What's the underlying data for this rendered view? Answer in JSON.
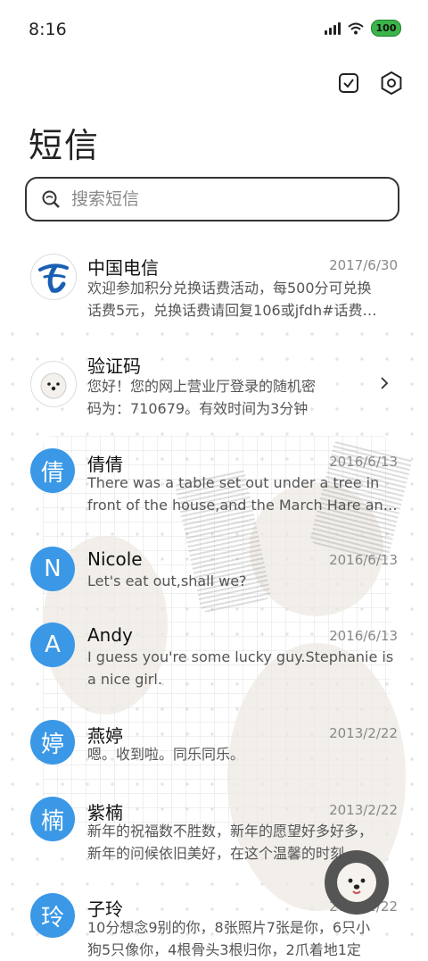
{
  "status": {
    "time": "8:16",
    "battery": "100"
  },
  "header": {
    "title": "短信"
  },
  "search": {
    "placeholder": "搜索短信"
  },
  "conversations": [
    {
      "name": "中国电信",
      "date": "2017/6/30",
      "lines": [
        "欢迎参加积分兑换话费活动，每500分可兑换",
        "话费5元，兑换话费请回复106或jfdh#话费…"
      ],
      "avatar_text": ""
    },
    {
      "name": "验证码",
      "date": "",
      "lines": [
        "您好！您的网上营业厅登录的随机密",
        "码为：710679。有效时间为3分钟"
      ],
      "avatar_text": ""
    },
    {
      "name": "倩倩",
      "date": "2016/6/13",
      "lines": [
        "There was a table set out under a tree in",
        "front of the house,and the March Hare an…"
      ],
      "avatar_text": "倩"
    },
    {
      "name": "Nicole",
      "date": "2016/6/13",
      "lines": [
        "Let's eat out,shall we?"
      ],
      "avatar_text": "N"
    },
    {
      "name": "Andy",
      "date": "2016/6/13",
      "lines": [
        "I guess you're some lucky guy.Stephanie is",
        "a nice girl."
      ],
      "avatar_text": "A"
    },
    {
      "name": "燕婷",
      "date": "2013/2/22",
      "lines": [
        "嗯。收到啦。同乐同乐。"
      ],
      "avatar_text": "婷"
    },
    {
      "name": "紫楠",
      "date": "2013/2/22",
      "lines": [
        "新年的祝福数不胜数，新年的愿望好多好多，",
        "新年的问候依旧美好，在这个温馨的时刻…"
      ],
      "avatar_text": "楠"
    },
    {
      "name": "子玲",
      "date": "2013/2/22",
      "lines": [
        "10分想念9别的你，8张照片7张是你，6只小",
        "狗5只像你，4根骨头3根归你，2爪着地1定"
      ],
      "avatar_text": "玲"
    }
  ],
  "colors": {
    "avatar_blue": "#3a98e6",
    "telecom_blue": "#1a5fb4"
  }
}
